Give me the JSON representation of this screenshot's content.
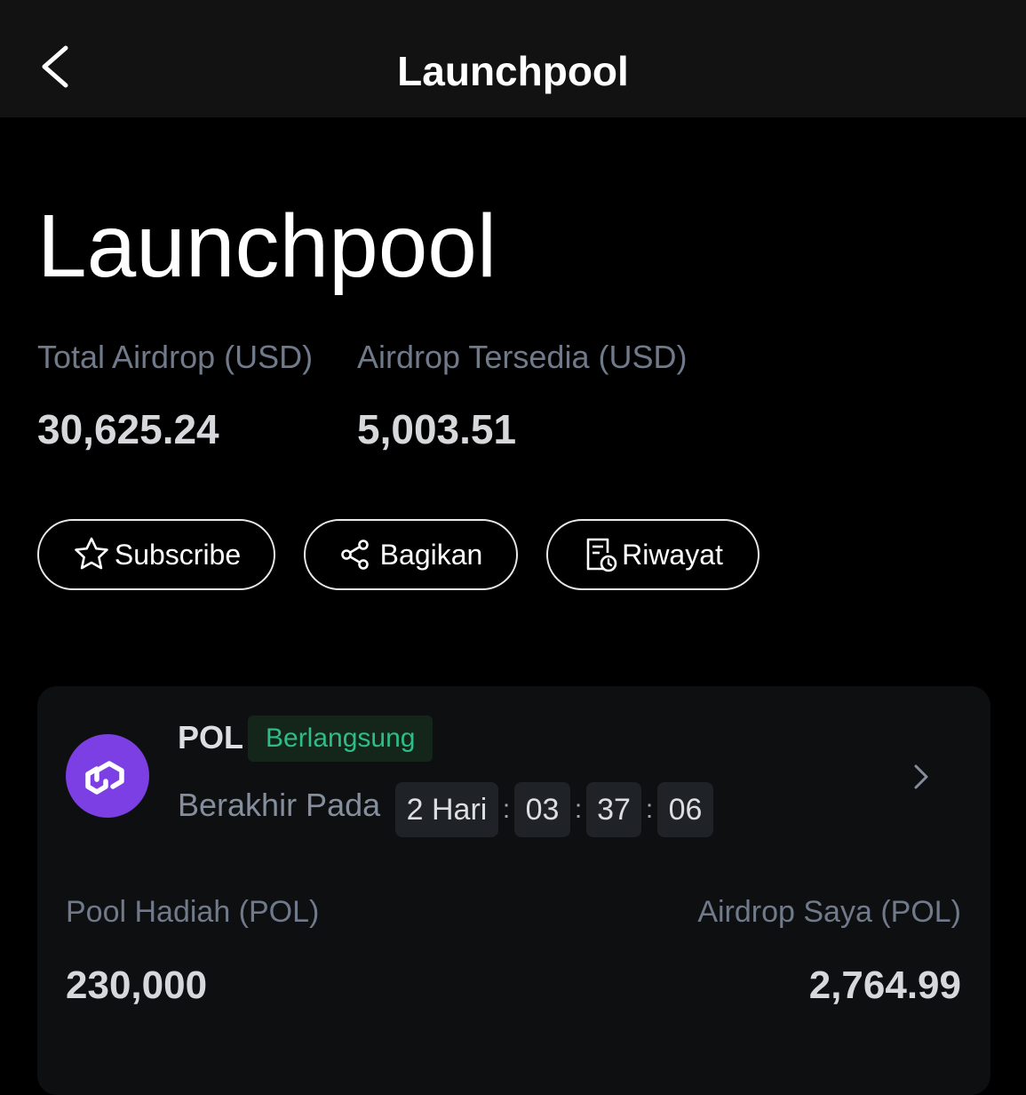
{
  "header": {
    "title": "Launchpool"
  },
  "hero": {
    "title": "Launchpool"
  },
  "stats": {
    "total_airdrop_label": "Total Airdrop (USD)",
    "total_airdrop_value": "30,625.24",
    "available_airdrop_label": "Airdrop Tersedia (USD)",
    "available_airdrop_value": "5,003.51"
  },
  "actions": {
    "subscribe_label": "Subscribe",
    "share_label": "Bagikan",
    "history_label": "Riwayat"
  },
  "pool_card": {
    "coin": "POL",
    "status": "Berlangsung",
    "ends_label": "Berakhir Pada",
    "timer": {
      "days": "2 Hari",
      "hours": "03",
      "minutes": "37",
      "seconds": "06",
      "separator": ":"
    },
    "prize_pool_label": "Pool Hadiah (POL)",
    "prize_pool_value": "230,000",
    "my_airdrop_label": "Airdrop Saya (POL)",
    "my_airdrop_value": "2,764.99"
  },
  "colors": {
    "background": "#000000",
    "topbar": "#121212",
    "card": "#0e0f11",
    "accent_green": "#2ebd85",
    "polygon_purple": "#7b3fe4"
  },
  "icons": {
    "back": "chevron-left-icon",
    "subscribe": "star-icon",
    "share": "share-icon",
    "history": "history-document-icon",
    "card_nav": "chevron-right-icon",
    "coin_logo": "polygon-logo-icon"
  }
}
